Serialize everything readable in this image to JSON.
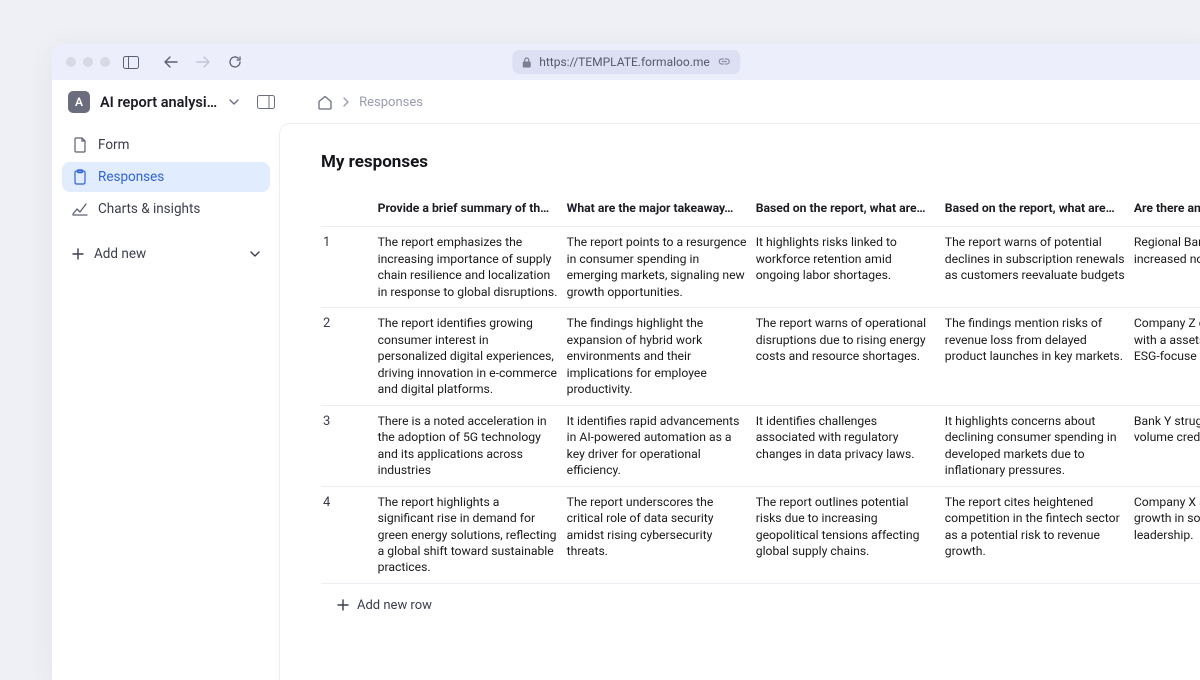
{
  "browser": {
    "url": "https://TEMPLATE.formaloo.me"
  },
  "app": {
    "logo_letter": "A",
    "title": "AI report analysi…",
    "breadcrumb_current": "Responses"
  },
  "sidebar": {
    "items": [
      {
        "label": "Form"
      },
      {
        "label": "Responses"
      },
      {
        "label": "Charts & insights"
      }
    ],
    "add_new": "Add new"
  },
  "main": {
    "heading": "My responses",
    "add_row": "Add new row",
    "columns": [
      "Provide a brief summary of th…",
      "What are the major takeaway…",
      "Based on the report, what are…",
      "Based on the report, what are…",
      "Are there any finan…"
    ],
    "rows": [
      {
        "n": "1",
        "c": [
          "The report emphasizes the increasing importance of supply chain resilience and localization in response to global disruptions.",
          "The report points to a resurgence in consumer spending in emerging markets, signaling new growth opportunities.",
          "It highlights risks linked to workforce retention amid ongoing labor shortages.",
          "The report warns of potential declines in subscription renewals as customers reevaluate budgets",
          "Regional Bank A fa from increased nor loans in its portfoli"
        ]
      },
      {
        "n": "2",
        "c": [
          "The report identifies growing consumer interest in personalized digital experiences, driving innovation in e-commerce and digital platforms.",
          "The findings highlight the expansion of hybrid work environments and their implications for employee productivity.",
          "The report warns of operational disruptions due to rising energy costs and resource shortages.",
          "The findings mention risks of revenue loss from delayed product launches in key markets.",
          "Company Z outper competitors with a assets under mana robust ESG-focuse"
        ]
      },
      {
        "n": "3",
        "c": [
          "There is a noted acceleration in the adoption of 5G technology and its applications across industries",
          "It identifies rapid advancements in AI-powered automation as a key driver for operational efficiency.",
          "It identifies challenges associated with regulatory changes in data privacy laws.",
          "It highlights concerns about declining consumer spending in developed markets due to inflationary pressures.",
          "Bank Y struggled w origination volume credit conditions."
        ]
      },
      {
        "n": "4",
        "c": [
          "The report highlights a significant rise in demand for green energy solutions, reflecting a global shift toward sustainable practices.",
          "The report underscores the critical role of data security amidst rising cybersecurity threats.",
          "The report outlines potential risks due to increasing geopolitical tensions affecting global supply chains.",
          "The report cites heightened competition in the fintech sector as a potential risk to revenue growth.",
          "Company X achiev breaking growth in solutions, solidifyi leadership."
        ]
      }
    ]
  }
}
